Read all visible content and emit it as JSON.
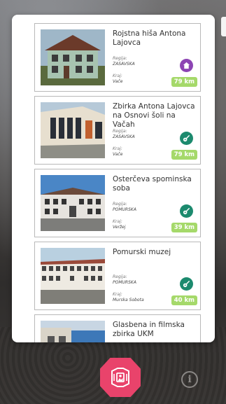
{
  "items": [
    {
      "title": "Rojstna hiša Antona Lajovca",
      "region_label": "Regija:",
      "region": "ZASAVSKA",
      "place_label": "Kraj:",
      "place": "Vače",
      "distance": "79 km",
      "badge_icon": "house-icon",
      "badge_color": "#8c44b3"
    },
    {
      "title": "Zbirka Antona Lajovca na Osnovi šoli na Vačah",
      "region_label": "Regija:",
      "region": "ZASAVSKA",
      "place_label": "Kraj:",
      "place": "Vače",
      "distance": "79 km",
      "badge_icon": "guitar-icon",
      "badge_color": "#1c8a6e"
    },
    {
      "title": "Osterčeva spominska soba",
      "region_label": "Regija:",
      "region": "POMURSKA",
      "place_label": "Kraj:",
      "place": "Veržej",
      "distance": "39 km",
      "badge_icon": "guitar-icon",
      "badge_color": "#1c8a6e"
    },
    {
      "title": "Pomurski muzej",
      "region_label": "Regija:",
      "region": "POMURSKA",
      "place_label": "Kraj:",
      "place": "Murska Sobota",
      "distance": "40 km",
      "badge_icon": "guitar-icon",
      "badge_color": "#1c8a6e"
    },
    {
      "title": "Glasbena in filmska zbirka UKM"
    }
  ],
  "info_glyph": "i",
  "colors": {
    "accent": "#e9436b",
    "distance": "#a5d96a"
  }
}
